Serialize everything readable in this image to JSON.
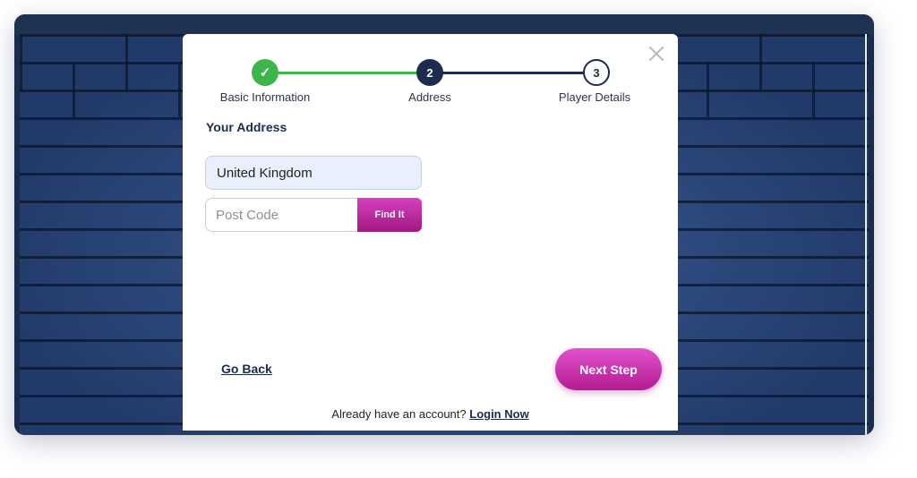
{
  "stepper": {
    "steps": [
      {
        "label": "Basic Information",
        "indicator": "✓",
        "state": "complete"
      },
      {
        "label": "Address",
        "indicator": "2",
        "state": "current"
      },
      {
        "label": "Player Details",
        "indicator": "3",
        "state": "upcoming"
      }
    ]
  },
  "form": {
    "section_title": "Your Address",
    "country_value": "United Kingdom",
    "postcode_placeholder": "Post Code",
    "find_button_label": "Find It"
  },
  "actions": {
    "back_label": "Go Back",
    "next_label": "Next Step"
  },
  "footer": {
    "prompt": "Already have an account?",
    "login_label": "Login Now"
  },
  "colors": {
    "complete": "#3db54a",
    "navy": "#1d2b4c",
    "accent_pink": "#c42aa8",
    "background": "#2f4f86"
  },
  "icons": {
    "close": "close-icon",
    "check": "check-icon"
  }
}
